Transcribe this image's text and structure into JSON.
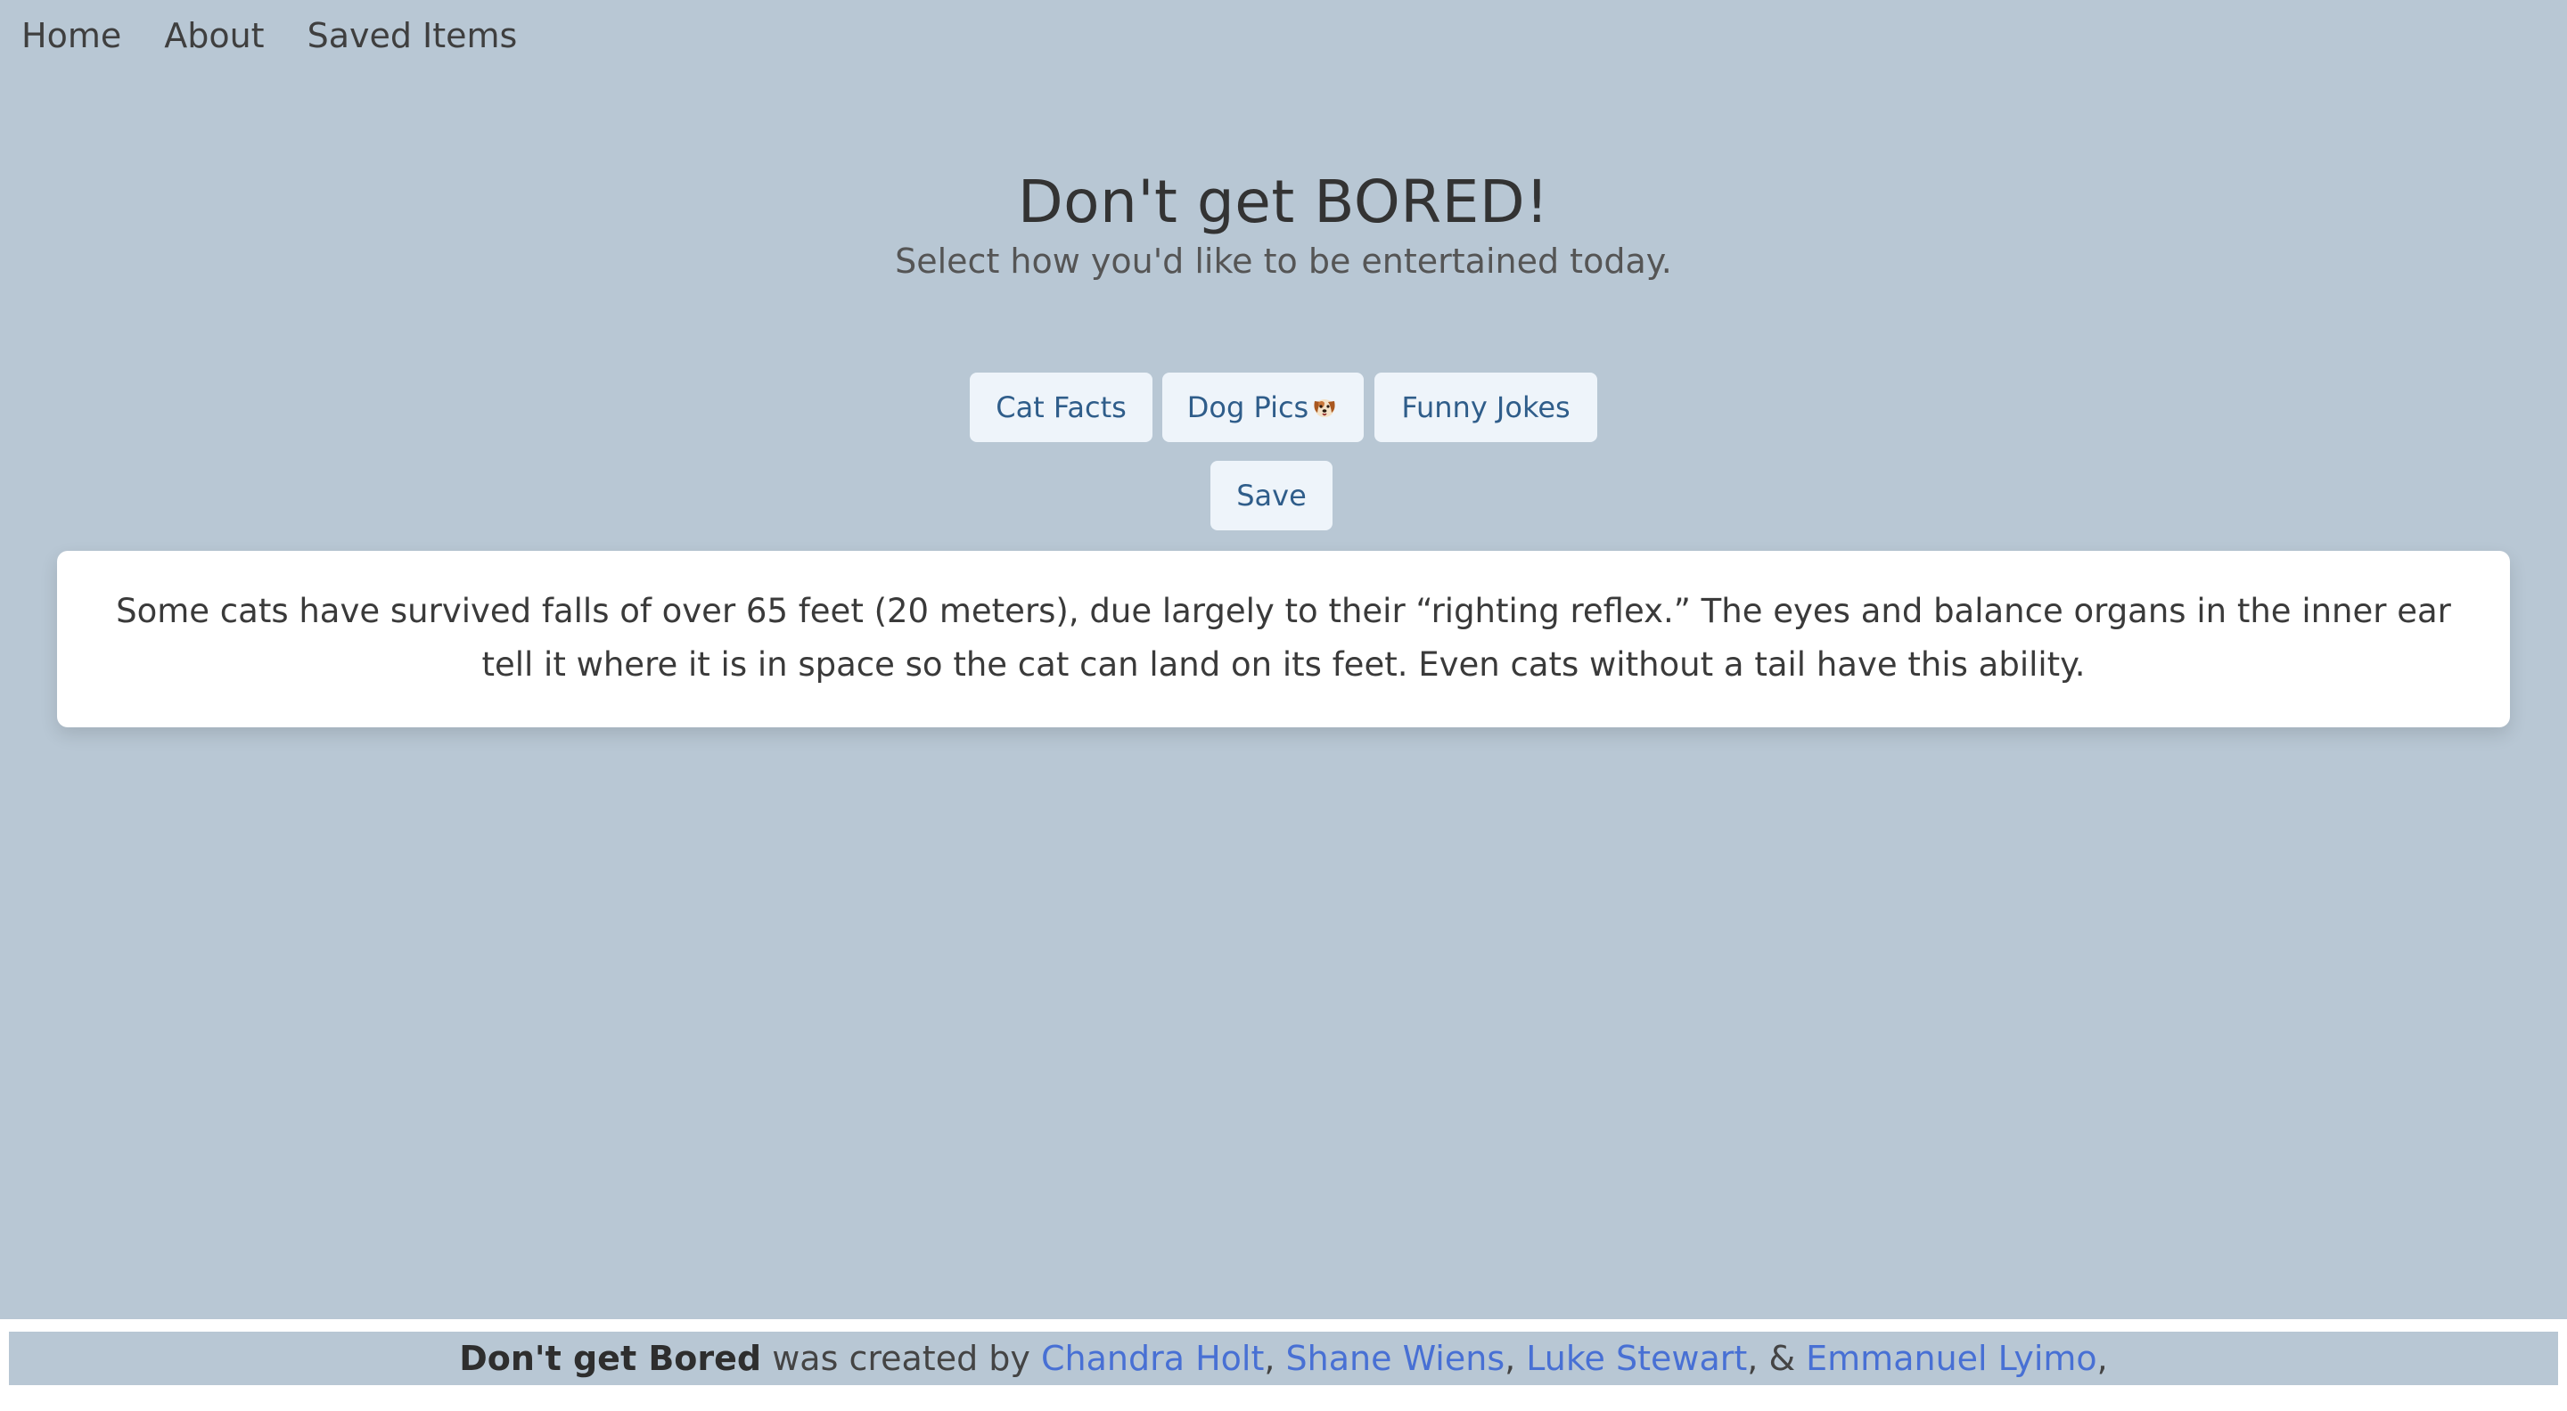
{
  "nav": {
    "items": [
      {
        "label": "Home"
      },
      {
        "label": "About"
      },
      {
        "label": "Saved Items"
      }
    ]
  },
  "hero": {
    "title": "Don't get BORED!",
    "subtitle": "Select how you'd like to be entertained today."
  },
  "buttons": {
    "cat_facts": "Cat Facts",
    "dog_pics": "Dog Pics",
    "dog_icon": "dog-face-icon",
    "funny_jokes": "Funny Jokes",
    "save": "Save"
  },
  "content": {
    "text": "Some cats have survived falls of over 65 feet (20 meters), due largely to their “righting reflex.” The eyes and balance organs in the inner ear tell it where it is in space so the cat can land on its feet. Even cats without a tail have this ability."
  },
  "footer": {
    "app_name": "Don't get Bored",
    "created_by": " was created by ",
    "authors": [
      {
        "name": "Chandra Holt"
      },
      {
        "name": "Shane Wiens"
      },
      {
        "name": "Luke Stewart"
      },
      {
        "name": "Emmanuel Lyimo"
      }
    ],
    "sep1": ", ",
    "sep2": ", ",
    "sep3": ", & ",
    "trailing": ","
  },
  "colors": {
    "background": "#b8c7d4",
    "button_bg": "#eef4fa",
    "button_text": "#2f5d8a",
    "link": "#4870d4"
  }
}
